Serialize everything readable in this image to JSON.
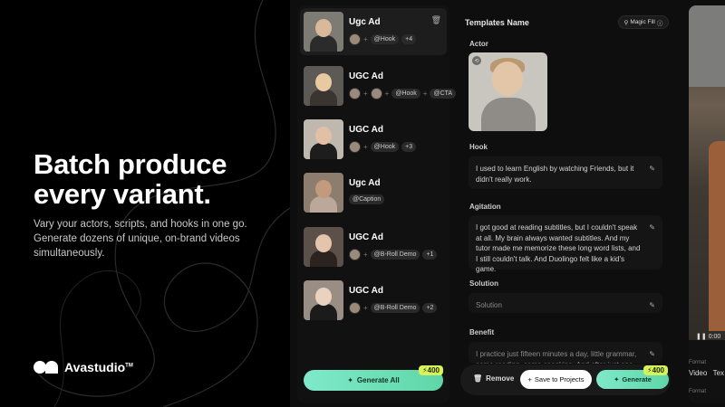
{
  "marketing": {
    "headline_line1": "Batch produce",
    "headline_line2": "every variant.",
    "subtext": "Vary your actors, scripts, and hooks in one go. Generate dozens of unique, on-brand videos simultaneously.",
    "brand": "Avastudio",
    "brand_tm": "TM"
  },
  "variants": [
    {
      "title": "Ugc Ad",
      "tags": [
        "@Hook"
      ],
      "count": "+4",
      "skin": "#d9b99a",
      "shirt": "#2b2b2b",
      "bg": "#7e7a74",
      "avatars": 1
    },
    {
      "title": "UGC Ad",
      "tags": [
        "@Hook",
        "@CTA"
      ],
      "count": "",
      "skin": "#e9c9a2",
      "shirt": "#3a3530",
      "bg": "#5d5a55",
      "avatars": 2
    },
    {
      "title": "UGC Ad",
      "tags": [
        "@Hook"
      ],
      "count": "+3",
      "skin": "#e2c0a6",
      "shirt": "#1d1d1d",
      "bg": "#bfb8ae",
      "avatars": 1
    },
    {
      "title": "Ugc Ad",
      "tags": [
        "@Caption"
      ],
      "count": "",
      "skin": "#c49a7d",
      "shirt": "#bca89a",
      "bg": "#8c7d6e",
      "avatars": 0
    },
    {
      "title": "UGC Ad",
      "tags": [
        "@B-Roll Demo"
      ],
      "count": "+1",
      "skin": "#e5c4ac",
      "shirt": "#2b2320",
      "bg": "#5c504a",
      "avatars": 1
    },
    {
      "title": "UGC Ad",
      "tags": [
        "@B-Roll Demo"
      ],
      "count": "+2",
      "skin": "#ead2be",
      "shirt": "#1b1b1b",
      "bg": "#9a8e84",
      "avatars": 1
    }
  ],
  "generate_all": {
    "label": "Generate All",
    "credits": "400"
  },
  "form": {
    "title": "Templates Name",
    "magic_fill": "Magic Fill",
    "actor_label": "Actor",
    "hook_label": "Hook",
    "hook_text": "I used to learn English by watching Friends, but it didn't really work.",
    "agitation_label": "Agitation",
    "agitation_text": "I got good at reading subtitles, but I couldn't speak at all. My brain always wanted subtitles. And my tutor made me memorize these long word lists, and I still couldn't talk. And Duolingo felt like a kid's game.",
    "solution_label": "Solution",
    "solution_placeholder": "Solution",
    "benefit_label": "Benefit",
    "benefit_text": "I practice just fifteen minutes a day, little grammar, some reading, some speaking. And after just one"
  },
  "actions": {
    "remove": "Remove",
    "save": "Save to Projects",
    "generate": "Generate",
    "credits": "400"
  },
  "preview": {
    "time": "0:00",
    "format_label": "Format",
    "video": "Video",
    "text": "Tex"
  }
}
